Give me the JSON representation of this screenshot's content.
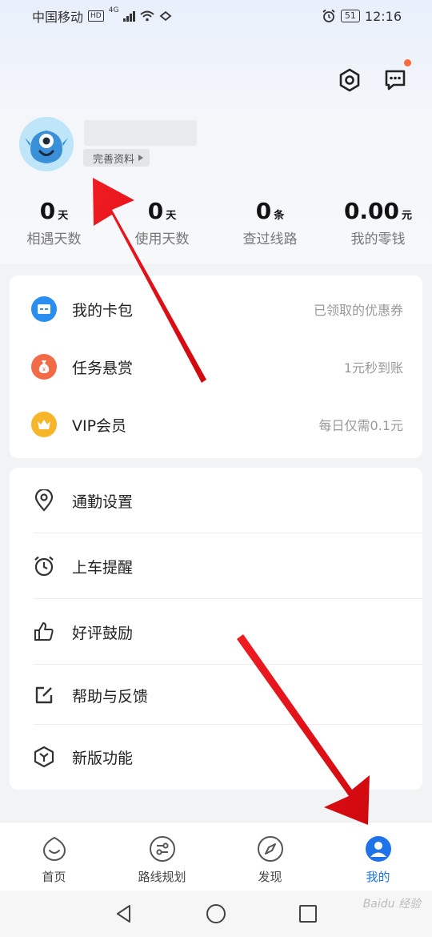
{
  "status_bar": {
    "carrier": "中国移动",
    "hd": "HD",
    "network": "4G",
    "battery": "51",
    "time": "12:16"
  },
  "header": {
    "settings_icon": "settings-hexagon-icon",
    "message_icon": "message-icon"
  },
  "profile": {
    "complete_button": "完善资料"
  },
  "stats": [
    {
      "value": "0",
      "unit": "天",
      "label": "相遇天数"
    },
    {
      "value": "0",
      "unit": "天",
      "label": "使用天数"
    },
    {
      "value": "0",
      "unit": "条",
      "label": "查过线路"
    },
    {
      "value": "0.00",
      "unit": "元",
      "label": "我的零钱"
    }
  ],
  "card1": [
    {
      "label": "我的卡包",
      "right": "已领取的优惠券",
      "icon": "wallet-icon",
      "color": "#2a8ef0"
    },
    {
      "label": "任务悬赏",
      "right": "1元秒到账",
      "icon": "money-bag-icon",
      "color": "#f26a48"
    },
    {
      "label": "VIP会员",
      "right": "每日仅需0.1元",
      "icon": "crown-icon",
      "color": "#f7b52a"
    }
  ],
  "card2": [
    {
      "label": "通勤设置",
      "icon": "location-pin-icon"
    },
    {
      "label": "上车提醒",
      "icon": "alarm-clock-icon"
    },
    {
      "label": "好评鼓励",
      "icon": "thumbs-up-icon"
    },
    {
      "label": "帮助与反馈",
      "icon": "edit-icon"
    },
    {
      "label": "新版功能",
      "icon": "new-feature-icon"
    }
  ],
  "tabs": [
    {
      "label": "首页",
      "icon": "home-smile-icon"
    },
    {
      "label": "路线规划",
      "icon": "route-icon"
    },
    {
      "label": "发现",
      "icon": "compass-icon"
    },
    {
      "label": "我的",
      "icon": "user-icon",
      "active": true
    }
  ],
  "colors": {
    "accent": "#1f73e8",
    "notification": "#ff6a3d",
    "annotation_arrow": "#e8161c"
  },
  "watermark": "Baidu 经验"
}
